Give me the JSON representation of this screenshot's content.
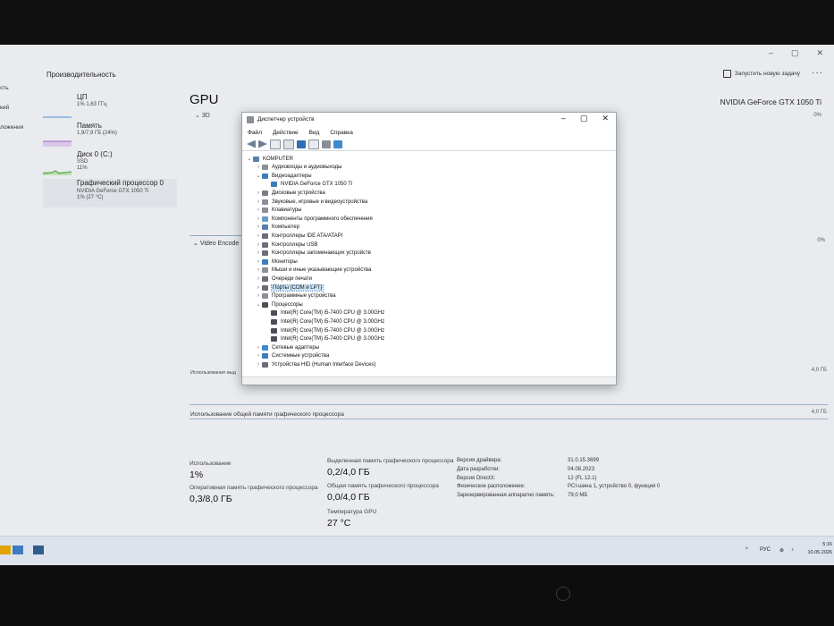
{
  "taskmanager": {
    "title": "Производительность",
    "run_task": "Запустить новую задачу",
    "more": "···",
    "window_controls": [
      "–",
      "▢",
      "✕"
    ],
    "left_nav": [
      "сть",
      "кий",
      "ложения"
    ],
    "sidebar": [
      {
        "name": "ЦП",
        "sub1": "1% 1,63 ГГц",
        "sub2": ""
      },
      {
        "name": "Память",
        "sub1": "1,9/7,9 ГБ (24%)",
        "sub2": ""
      },
      {
        "name": "Диск 0 (C:)",
        "sub1": "SSD",
        "sub2": "11%"
      },
      {
        "name": "Графический процессор 0",
        "sub1": "NVIDIA GeForce GTX 1050 Ti",
        "sub2": "1% (27 °C)"
      }
    ],
    "gpu": {
      "title": "GPU",
      "model": "NVIDIA GeForce GTX 1050 Ti",
      "graph_3d": "3D",
      "pct_3d": "0%",
      "video_encode": "Video Encode",
      "pct_encode": "0%",
      "dedicated_label": "Использование выд",
      "dedicated_max": "4,0 ГБ",
      "shared_label": "Использование общей памяти графического процессора",
      "shared_max": "4,0 ГБ"
    },
    "stats": {
      "usage_k": "Использование",
      "usage_v": "1%",
      "gpu_ram_k": "Оперативная память графического процессора",
      "gpu_ram_v": "0,3/8,0 ГБ",
      "ded_k": "Выделенная память графического процессора",
      "ded_v": "0,2/4,0 ГБ",
      "shared_k": "Общая память графического процессора",
      "shared_v": "0,0/4,0 ГБ",
      "temp_k": "Температура GPU",
      "temp_v": "27 °C"
    },
    "info": [
      {
        "k": "Версия драйвера:",
        "v": "31.0.15.3699"
      },
      {
        "k": "Дата разработки:",
        "v": "04.08.2023"
      },
      {
        "k": "Версия DirectX:",
        "v": "12 (FL 12.1)"
      },
      {
        "k": "Физическое расположение:",
        "v": "PCI-шина 1, устройство 0, функция 0"
      },
      {
        "k": "Зарезервированная аппаратно память:",
        "v": "79,0 МБ"
      }
    ]
  },
  "device_manager": {
    "title": "Диспетчер устройств",
    "controls": [
      "–",
      "▢",
      "✕"
    ],
    "menu": [
      "Файл",
      "Действие",
      "Вид",
      "Справка"
    ],
    "tree": [
      {
        "label": "KOMPUTER",
        "level": 0,
        "expanded": true,
        "icon": "computer-icon",
        "color": "#5b7fa6"
      },
      {
        "label": "Аудиовходы и аудиовыходы",
        "level": 1,
        "expanded": false,
        "icon": "speaker-icon",
        "color": "#8a8f98"
      },
      {
        "label": "Видеоадаптеры",
        "level": 1,
        "expanded": true,
        "icon": "display-adapter-icon",
        "color": "#3d7cbf"
      },
      {
        "label": "NVIDIA GeForce GTX 1050 Ti",
        "level": 2,
        "leaf": true,
        "icon": "display-adapter-icon",
        "color": "#3d7cbf"
      },
      {
        "label": "Дисковые устройства",
        "level": 1,
        "expanded": false,
        "icon": "disk-icon",
        "color": "#7a7f87"
      },
      {
        "label": "Звуковые, игровые и видеоустройства",
        "level": 1,
        "expanded": false,
        "icon": "speaker-icon",
        "color": "#8a8f98"
      },
      {
        "label": "Клавиатуры",
        "level": 1,
        "expanded": false,
        "icon": "keyboard-icon",
        "color": "#8a8f98"
      },
      {
        "label": "Компоненты программного обеспечения",
        "level": 1,
        "expanded": false,
        "icon": "component-icon",
        "color": "#6c9bc8"
      },
      {
        "label": "Компьютер",
        "level": 1,
        "expanded": false,
        "icon": "computer-icon",
        "color": "#5b7fa6"
      },
      {
        "label": "Контроллеры IDE ATA/ATAPI",
        "level": 1,
        "expanded": false,
        "icon": "controller-icon",
        "color": "#6a6f77"
      },
      {
        "label": "Контроллеры USB",
        "level": 1,
        "expanded": false,
        "icon": "usb-icon",
        "color": "#6a6f77"
      },
      {
        "label": "Контроллеры запоминающих устройств",
        "level": 1,
        "expanded": false,
        "icon": "storage-icon",
        "color": "#6a6f77"
      },
      {
        "label": "Мониторы",
        "level": 1,
        "expanded": false,
        "icon": "monitor-icon",
        "color": "#3d7cbf"
      },
      {
        "label": "Мыши и иные указывающие устройства",
        "level": 1,
        "expanded": false,
        "icon": "mouse-icon",
        "color": "#8a8f98"
      },
      {
        "label": "Очереди печати",
        "level": 1,
        "expanded": false,
        "icon": "printer-icon",
        "color": "#6a6f77"
      },
      {
        "label": "Порты (COM и LPT)",
        "level": 1,
        "expanded": false,
        "icon": "port-icon",
        "color": "#6a6f77",
        "selected": true
      },
      {
        "label": "Программные устройства",
        "level": 1,
        "expanded": false,
        "icon": "software-device-icon",
        "color": "#8a8f98"
      },
      {
        "label": "Процессоры",
        "level": 1,
        "expanded": true,
        "icon": "processor-icon",
        "color": "#4a4f57"
      },
      {
        "label": "Intel(R) Core(TM) i5-7400 CPU @ 3.00GHz",
        "level": 2,
        "leaf": true,
        "icon": "processor-icon",
        "color": "#4a4f57"
      },
      {
        "label": "Intel(R) Core(TM) i5-7400 CPU @ 3.00GHz",
        "level": 2,
        "leaf": true,
        "icon": "processor-icon",
        "color": "#4a4f57"
      },
      {
        "label": "Intel(R) Core(TM) i5-7400 CPU @ 3.00GHz",
        "level": 2,
        "leaf": true,
        "icon": "processor-icon",
        "color": "#4a4f57"
      },
      {
        "label": "Intel(R) Core(TM) i5-7400 CPU @ 3.00GHz",
        "level": 2,
        "leaf": true,
        "icon": "processor-icon",
        "color": "#4a4f57"
      },
      {
        "label": "Сетевые адаптеры",
        "level": 1,
        "expanded": false,
        "icon": "network-icon",
        "color": "#3d8bcf"
      },
      {
        "label": "Системные устройства",
        "level": 1,
        "expanded": false,
        "icon": "system-device-icon",
        "color": "#3d7cbf"
      },
      {
        "label": "Устройства HID (Human Interface Devices)",
        "level": 1,
        "expanded": false,
        "icon": "hid-icon",
        "color": "#6a6f77"
      }
    ]
  },
  "taskbar": {
    "lang": "РУС",
    "time": "5:16",
    "date": "10.05.2026"
  }
}
